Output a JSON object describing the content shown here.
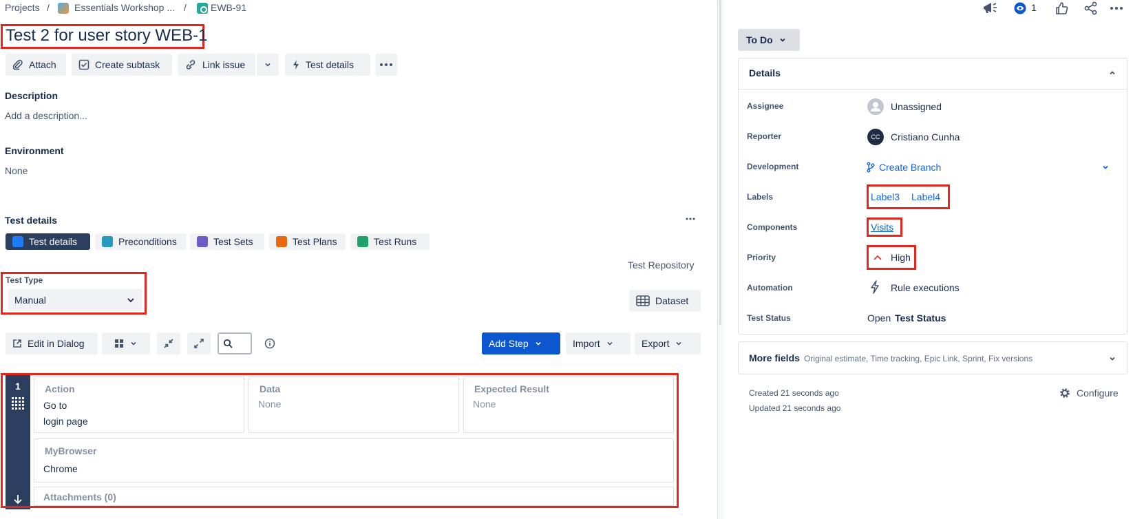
{
  "breadcrumb": {
    "projects": "Projects",
    "project": "Essentials Workshop ...",
    "issue": "EWB-91",
    "sep": "/"
  },
  "issue": {
    "title": "Test 2 for user story WEB-1"
  },
  "toolbar": {
    "attach": "Attach",
    "create_subtask": "Create subtask",
    "link_issue": "Link issue",
    "test_details": "Test details"
  },
  "description": {
    "heading": "Description",
    "placeholder": "Add a description..."
  },
  "environment": {
    "heading": "Environment",
    "value": "None"
  },
  "test_details": {
    "heading": "Test details",
    "tabs": [
      {
        "label": "Test details",
        "color": "#1d7afc"
      },
      {
        "label": "Preconditions",
        "color": "#2898bd"
      },
      {
        "label": "Test Sets",
        "color": "#6e5dc6"
      },
      {
        "label": "Test Plans",
        "color": "#e56910"
      },
      {
        "label": "Test Runs",
        "color": "#22a06b"
      }
    ],
    "repository_link": "Test Repository",
    "test_type_label": "Test Type",
    "test_type_value": "Manual",
    "dataset": "Dataset",
    "edit_in_dialog": "Edit in Dialog",
    "add_step": "Add Step",
    "import": "Import",
    "export": "Export"
  },
  "step": {
    "number": "1",
    "action_header": "Action",
    "action_value_line1": "Go to",
    "action_value_line2": "login page",
    "data_header": "Data",
    "data_value": "None",
    "expected_header": "Expected Result",
    "expected_value": "None",
    "custom_header": "MyBrowser",
    "custom_value": "Chrome",
    "attachments": "Attachments (0)"
  },
  "header_actions": {
    "watch_count": "1"
  },
  "sidebar": {
    "status": "To Do",
    "details_title": "Details",
    "fields": {
      "assignee_label": "Assignee",
      "assignee_value": "Unassigned",
      "reporter_label": "Reporter",
      "reporter_value": "Cristiano Cunha",
      "reporter_initials": "CC",
      "development_label": "Development",
      "development_value": "Create Branch",
      "labels_label": "Labels",
      "label_1": "Label3",
      "label_2": "Label4",
      "components_label": "Components",
      "components_value": "Visits",
      "priority_label": "Priority",
      "priority_value": "High",
      "automation_label": "Automation",
      "automation_value": "Rule executions",
      "test_status_label": "Test Status",
      "test_status_prefix": "Open",
      "test_status_value": "Test Status"
    },
    "more_fields_title": "More fields",
    "more_fields_sub": "Original estimate, Time tracking, Epic Link, Sprint, Fix versions",
    "created": "Created 21 seconds ago",
    "updated": "Updated 21 seconds ago",
    "configure": "Configure"
  },
  "colors": {
    "primary": "#0c57d0",
    "highlight": "#e3261a",
    "priority_high": "#e2483d"
  }
}
